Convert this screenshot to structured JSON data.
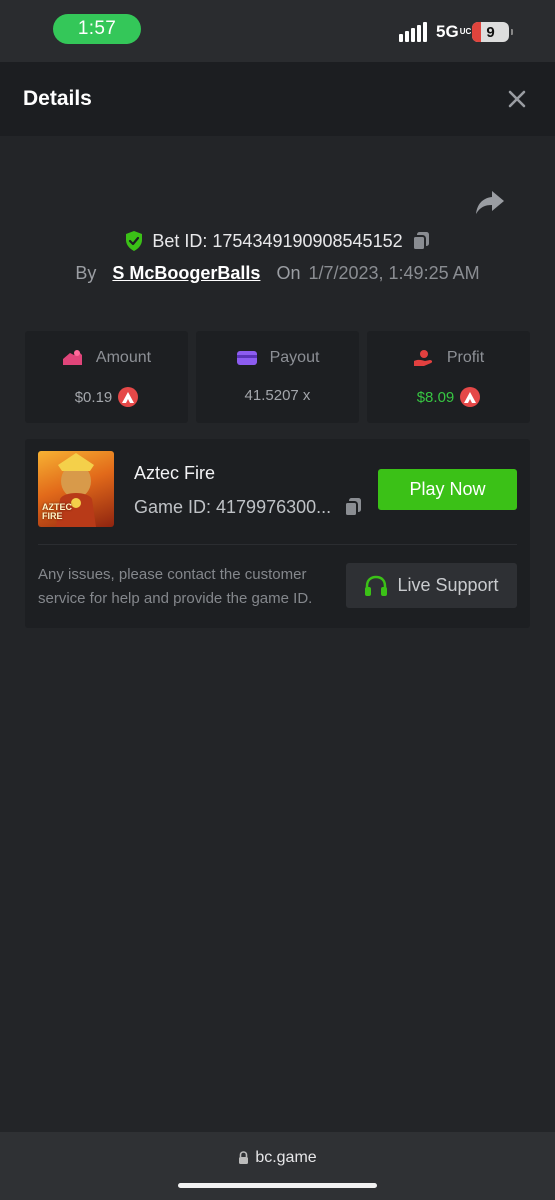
{
  "status_bar": {
    "time": "1:57",
    "network": "5G",
    "network_sub": "UC",
    "battery": "9"
  },
  "header": {
    "title": "Details"
  },
  "bet": {
    "id_text": "Bet ID: 1754349190908545152",
    "by_label": "By",
    "username": "S McBoogerBalls",
    "on_label": "On",
    "date": "1/7/2023, 1:49:25 AM"
  },
  "stats": {
    "amount_label": "Amount",
    "amount_value": "$0.19",
    "payout_label": "Payout",
    "payout_value": "41.5207 x",
    "profit_label": "Profit",
    "profit_value": "$8.09"
  },
  "game": {
    "name": "Aztec Fire",
    "id_text": "Game ID: 4179976300...",
    "thumb_logo_line1": "AZTEC",
    "thumb_logo_line2": "FIRE",
    "play_label": "Play Now",
    "help_text": "Any issues, please contact the customer service for help and provide the game ID.",
    "support_label": "Live Support"
  },
  "browser": {
    "url": "bc.game"
  },
  "colors": {
    "accent_green": "#3bc117",
    "profit_green": "#37c542",
    "coin_red": "#e54848",
    "background": "#232528"
  },
  "icons": [
    "shield-check-icon",
    "copy-icon",
    "share-icon",
    "close-icon",
    "amount-icon",
    "payout-card-icon",
    "profit-hand-icon",
    "coin-icon",
    "headset-icon",
    "lock-icon"
  ]
}
